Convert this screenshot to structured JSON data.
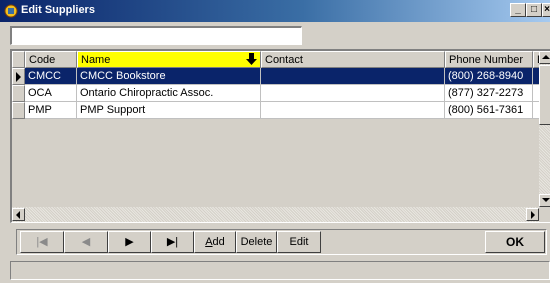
{
  "window": {
    "title": "Edit Suppliers",
    "minimize": "_",
    "maximize": "□",
    "close": "×"
  },
  "filter": {
    "value": "",
    "placeholder": ""
  },
  "grid": {
    "columns": [
      {
        "label": "Code"
      },
      {
        "label": "Name",
        "sorted": true
      },
      {
        "label": "Contact"
      },
      {
        "label": "Phone Number"
      },
      {
        "label": "E"
      }
    ],
    "sort_indicator": "🡇",
    "rows": [
      {
        "code": "CMCC",
        "name": "CMCC Bookstore",
        "contact": "",
        "phone": "(800) 268-8940",
        "extra": "",
        "selected": true
      },
      {
        "code": "OCA",
        "name": "Ontario Chiropractic Assoc.",
        "contact": "",
        "phone": "(877) 327-2273",
        "extra": "",
        "selected": false
      },
      {
        "code": "PMP",
        "name": "PMP Support",
        "contact": "",
        "phone": "(800) 561-7361",
        "extra": "",
        "selected": false
      }
    ]
  },
  "nav": {
    "first": "|◀",
    "prev": "◀",
    "next": "▶",
    "last": "▶|"
  },
  "buttons": {
    "add": {
      "mnemonic": "A",
      "rest": "dd"
    },
    "delete": "Delete",
    "edit": "Edit",
    "ok": "OK"
  },
  "status": {
    "text": ""
  },
  "colors": {
    "selected_row": "#0a246a",
    "sorted_header": "#ffff00",
    "title_bar": "#0a246a"
  },
  "icons": {
    "app": "suppliers-app-icon"
  }
}
